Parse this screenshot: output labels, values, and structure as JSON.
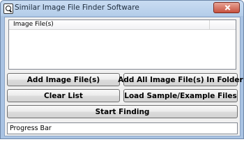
{
  "window": {
    "title": "Similar Image File Finder Software"
  },
  "file_list": {
    "column_header": "Image File(s)",
    "items": []
  },
  "buttons": {
    "add_files": "Add Image File(s)",
    "add_folder": "Add All Image File(s) In Folder",
    "clear_list": "Clear List",
    "load_sample": "Load Sample/Example Files",
    "start": "Start Finding"
  },
  "progress": {
    "label": "Progress Bar",
    "value": 0
  },
  "icons": {
    "app": "magnifier-app-icon",
    "close": "close-icon"
  },
  "colors": {
    "titlebar": "#b9d1ea",
    "close_button": "#c7513f",
    "client_bg": "#f0f0f0"
  }
}
